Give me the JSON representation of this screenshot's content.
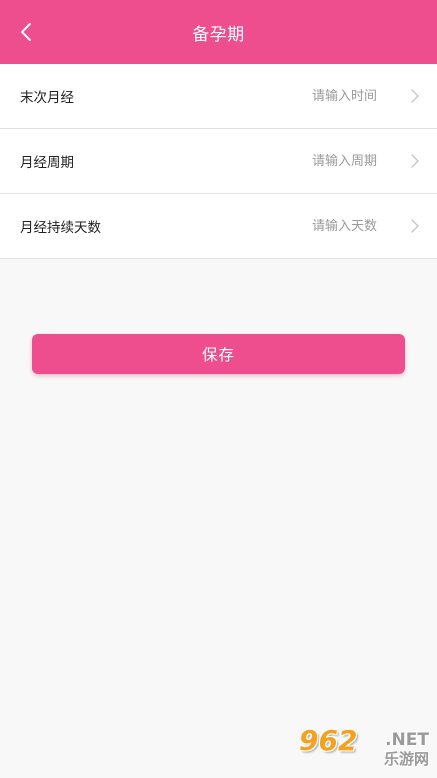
{
  "header": {
    "title": "备孕期",
    "back_icon": "chevron-left-icon",
    "background_color": "#ee4e8e"
  },
  "form": {
    "rows": [
      {
        "label": "末次月经",
        "placeholder": "请输入时间",
        "value": "",
        "icon": "chevron-right-icon"
      },
      {
        "label": "月经周期",
        "placeholder": "请输入周期",
        "value": "",
        "icon": "chevron-right-icon"
      },
      {
        "label": "月经持续天数",
        "placeholder": "请输入天数",
        "value": "",
        "icon": "chevron-right-icon"
      }
    ]
  },
  "save_button": {
    "label": "保存",
    "color": "#ee4e8e"
  },
  "watermark": {
    "digits": "962",
    "suffix": ".NET",
    "site_name": "乐游网"
  }
}
